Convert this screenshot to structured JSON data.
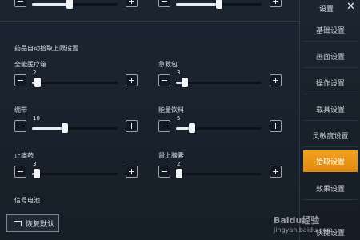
{
  "main": {
    "section_title": "药品自动拾取上限设置",
    "sliders": [
      {
        "label": "全能医疗箱",
        "value": "2",
        "fraction": 0.07
      },
      {
        "label": "急救包",
        "value": "3",
        "fraction": 0.1
      },
      {
        "label": "绷带",
        "value": "10",
        "fraction": 0.38
      },
      {
        "label": "能量饮料",
        "value": "5",
        "fraction": 0.19
      },
      {
        "label": "止痛药",
        "value": "3",
        "fraction": 0.06
      },
      {
        "label": "肾上腺素",
        "value": "2",
        "fraction": 0.04
      }
    ],
    "top_partial_sliders": [
      {
        "fraction": 0.44
      },
      {
        "fraction": 0.5
      }
    ],
    "signal_label": "信号电池",
    "reset_label": "恢复默认"
  },
  "sidebar": {
    "title": "设置",
    "close_glyph": "✕",
    "items": [
      {
        "label": "基础设置",
        "active": false
      },
      {
        "label": "画面设置",
        "active": false
      },
      {
        "label": "操作设置",
        "active": false
      },
      {
        "label": "载具设置",
        "active": false
      },
      {
        "label": "灵敏度设置",
        "active": false
      },
      {
        "label": "拾取设置",
        "active": true
      },
      {
        "label": "效果设置",
        "active": false
      },
      {
        "label": "快捷设置",
        "active": false
      }
    ]
  },
  "watermark": {
    "brand": "Baidu经验",
    "url": "jingyan.baidu.com"
  },
  "colors": {
    "accent": "#f2a01e",
    "background": "#1b2531"
  }
}
